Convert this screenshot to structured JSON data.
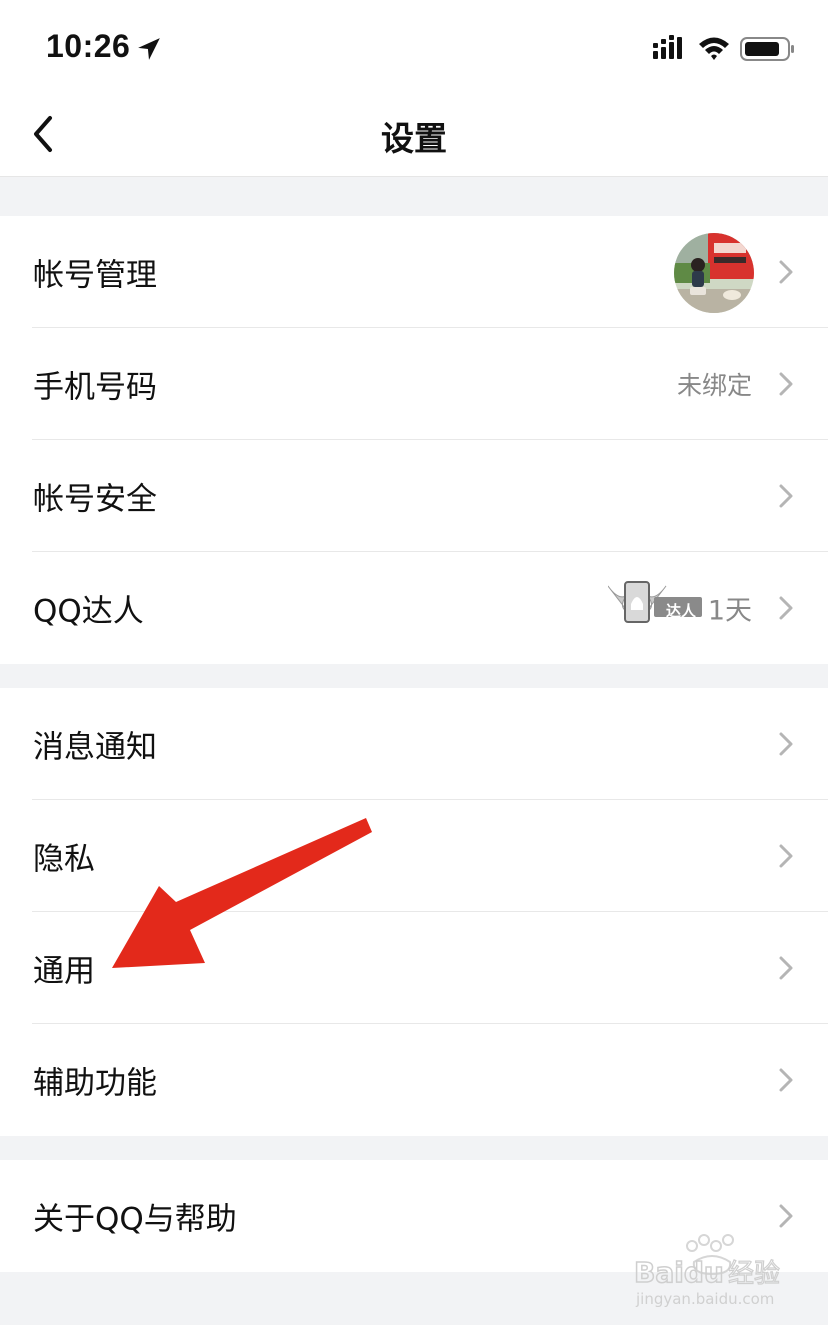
{
  "status_bar": {
    "time": "10:26",
    "icons": [
      "location-arrow-icon",
      "cellular-signal-icon",
      "wifi-icon",
      "battery-icon"
    ]
  },
  "nav": {
    "title": "设置",
    "back_icon": "chevron-left-icon"
  },
  "groups": [
    {
      "items": [
        {
          "label": "帐号管理",
          "value": "",
          "accessory": "avatar"
        },
        {
          "label": "手机号码",
          "value": "未绑定"
        },
        {
          "label": "帐号安全",
          "value": ""
        },
        {
          "label": "QQ达人",
          "value": "1天",
          "badge_text": "达人"
        }
      ]
    },
    {
      "items": [
        {
          "label": "消息通知",
          "value": ""
        },
        {
          "label": "隐私",
          "value": ""
        },
        {
          "label": "通用",
          "value": ""
        },
        {
          "label": "辅助功能",
          "value": ""
        }
      ]
    },
    {
      "items": [
        {
          "label": "关于QQ与帮助",
          "value": ""
        }
      ]
    }
  ],
  "annotation": {
    "type": "red-arrow",
    "points_to": "通用",
    "color": "#e3291b"
  },
  "watermark": {
    "brand": "Baidu经验",
    "url": "jingyan.baidu.com"
  },
  "colors": {
    "background": "#f2f3f5",
    "row_background": "#ffffff",
    "secondary_text": "#888888",
    "chevron": "#b5b5b5"
  }
}
